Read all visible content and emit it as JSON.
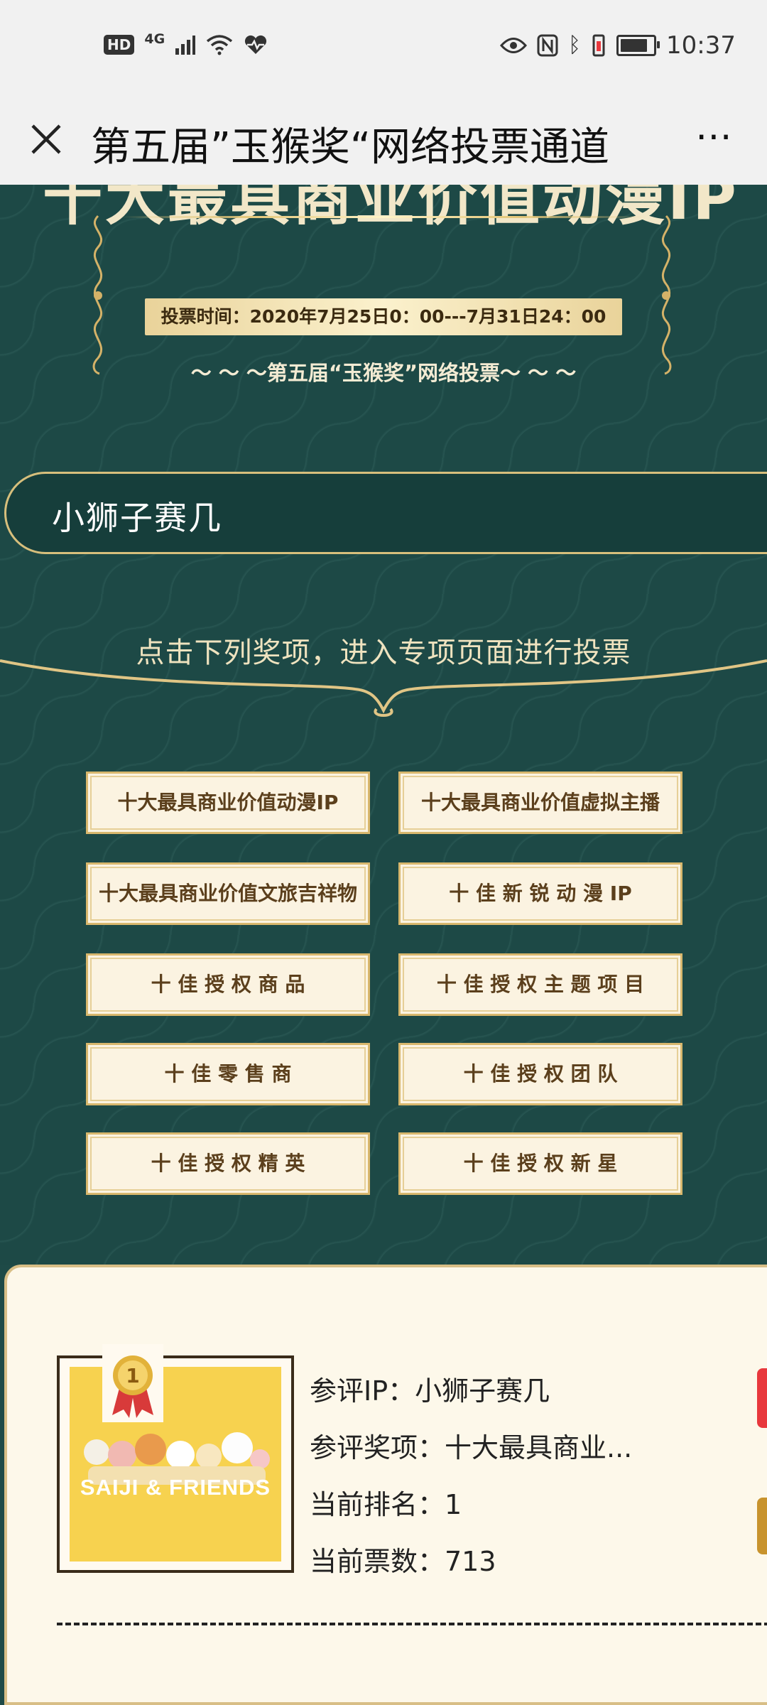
{
  "status_bar": {
    "hd": "HD",
    "network": "4G",
    "time": "10:37",
    "icons": [
      "hd-icon",
      "signal-icon",
      "wifi-icon",
      "heart-rate-icon",
      "eye-icon",
      "nfc-icon",
      "bluetooth-icon",
      "vibrate-icon",
      "battery-icon"
    ],
    "battery_level": 0.85
  },
  "title_bar": {
    "title": "第五届”玉猴奖“网络投票通道",
    "close_icon": "close-icon",
    "more_icon": "more-icon",
    "more_label": "⋯"
  },
  "hero": {
    "heading_cut": "十大最具商业价值动漫IP",
    "vote_time": "投票时间：2020年7月25日0：00---7月31日24：00",
    "subtitle": "～ ～ ～第五届“玉猴奖”网络投票～ ～ ～"
  },
  "candidate_banner": "小狮子赛几",
  "instruction": "点击下列奖项，进入专项页面进行投票",
  "awards": [
    "十大最具商业价值动漫IP",
    "十大最具商业价值虚拟主播",
    "十大最具商业价值文旅吉祥物",
    "十 佳 新 锐 动 漫 IP",
    "十 佳 授 权 商 品",
    "十 佳 授 权 主 题 项 目",
    "十 佳 零 售 商",
    "十 佳 授 权 团 队",
    "十 佳 授 权 精 英",
    "十 佳 授 权 新 星"
  ],
  "card": {
    "poster_brand": "SAIJI & FRIENDS",
    "medal_number": "1",
    "ip_line": "参评IP：小狮子赛几",
    "award_line": "参评奖项：十大最具商业...",
    "rank_line": "当前排名：1",
    "votes_line": "当前票数：713"
  },
  "colors": {
    "background_teal": "#1d4946",
    "gold": "#d8b76d",
    "button_cream": "#fbf3e1",
    "button_text": "#5b3f1c"
  }
}
